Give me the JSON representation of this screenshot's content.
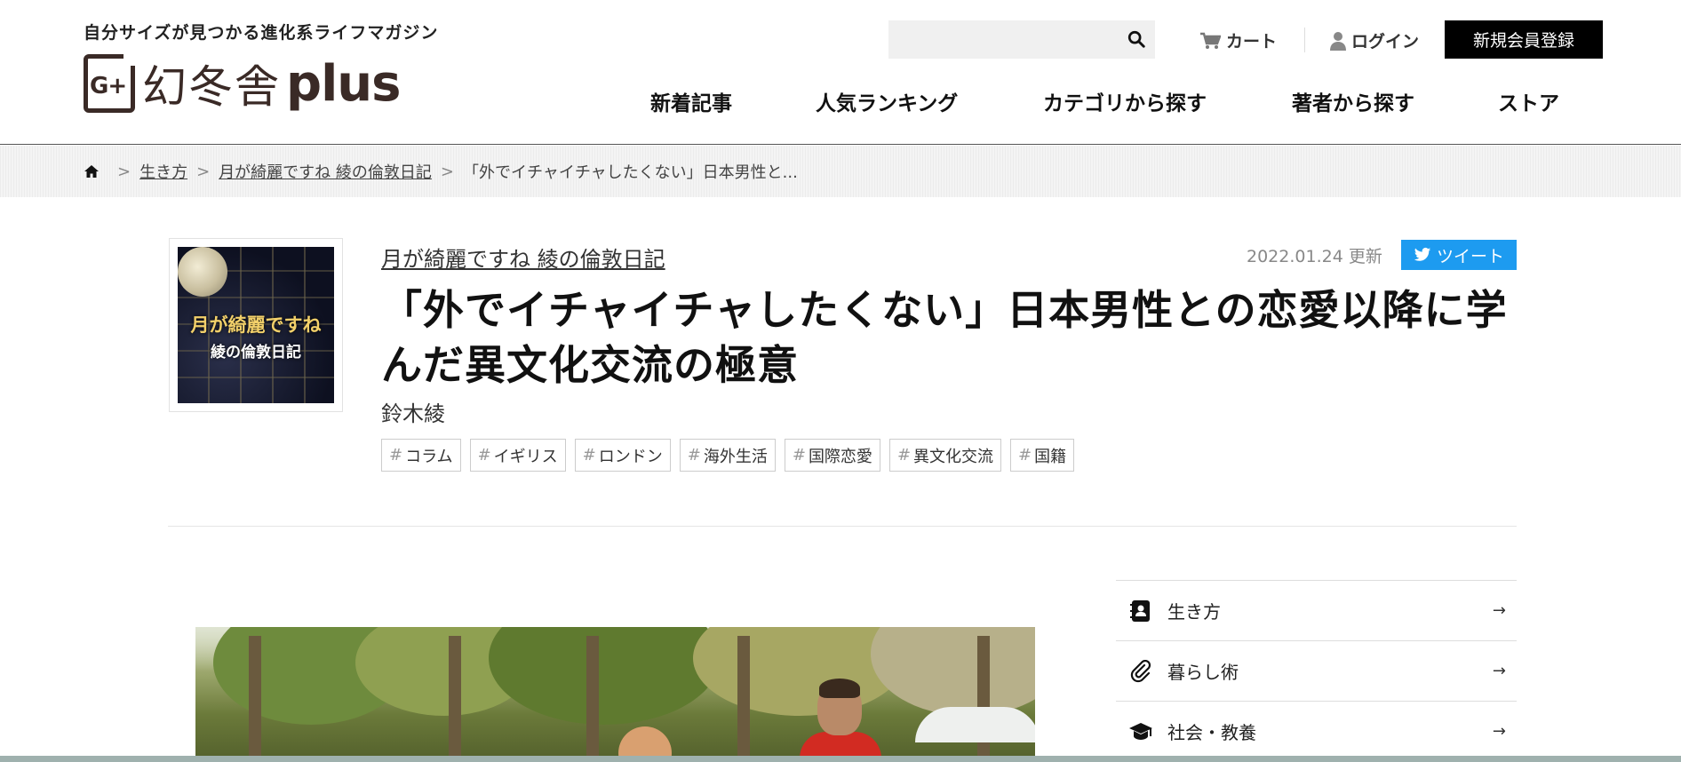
{
  "header": {
    "tagline": "自分サイズが見つかる進化系ライフマガジン",
    "logo_mark": "G+",
    "logo_jp": "幻冬舎",
    "logo_plus": "plus",
    "search_placeholder": "",
    "cart_label": "カート",
    "login_label": "ログイン",
    "register_label": "新規会員登録",
    "nav": [
      "新着記事",
      "人気ランキング",
      "カテゴリから探す",
      "著者から探す",
      "ストア"
    ]
  },
  "breadcrumb": {
    "items": [
      "生き方",
      "月が綺麗ですね 綾の倫敦日記"
    ],
    "current": "「外でイチャイチャしたくない」日本男性と...",
    "separator": ">"
  },
  "article": {
    "thumbnail_title": "月が綺麗ですね",
    "thumbnail_subtitle": "綾の倫敦日記",
    "series": "月が綺麗ですね 綾の倫敦日記",
    "updated": "2022.01.24 更新",
    "tweet_label": "ツイート",
    "title": "「外でイチャイチャしたくない」日本男性との恋愛以降に学んだ異文化交流の極意",
    "author": "鈴木綾",
    "tags": [
      "コラム",
      "イギリス",
      "ロンドン",
      "海外生活",
      "国際恋愛",
      "異文化交流",
      "国籍"
    ],
    "tag_prefix": "#"
  },
  "sidebar": {
    "categories": [
      {
        "label": "生き方",
        "icon": "contact-book-icon",
        "arrow": "→"
      },
      {
        "label": "暮らし術",
        "icon": "paperclip-icon",
        "arrow": "→"
      },
      {
        "label": "社会・教養",
        "icon": "graduation-cap-icon",
        "arrow": "→"
      }
    ]
  },
  "colors": {
    "tweet": "#1d9bf0",
    "register_bg": "#000000",
    "logo": "#3a2a26"
  }
}
